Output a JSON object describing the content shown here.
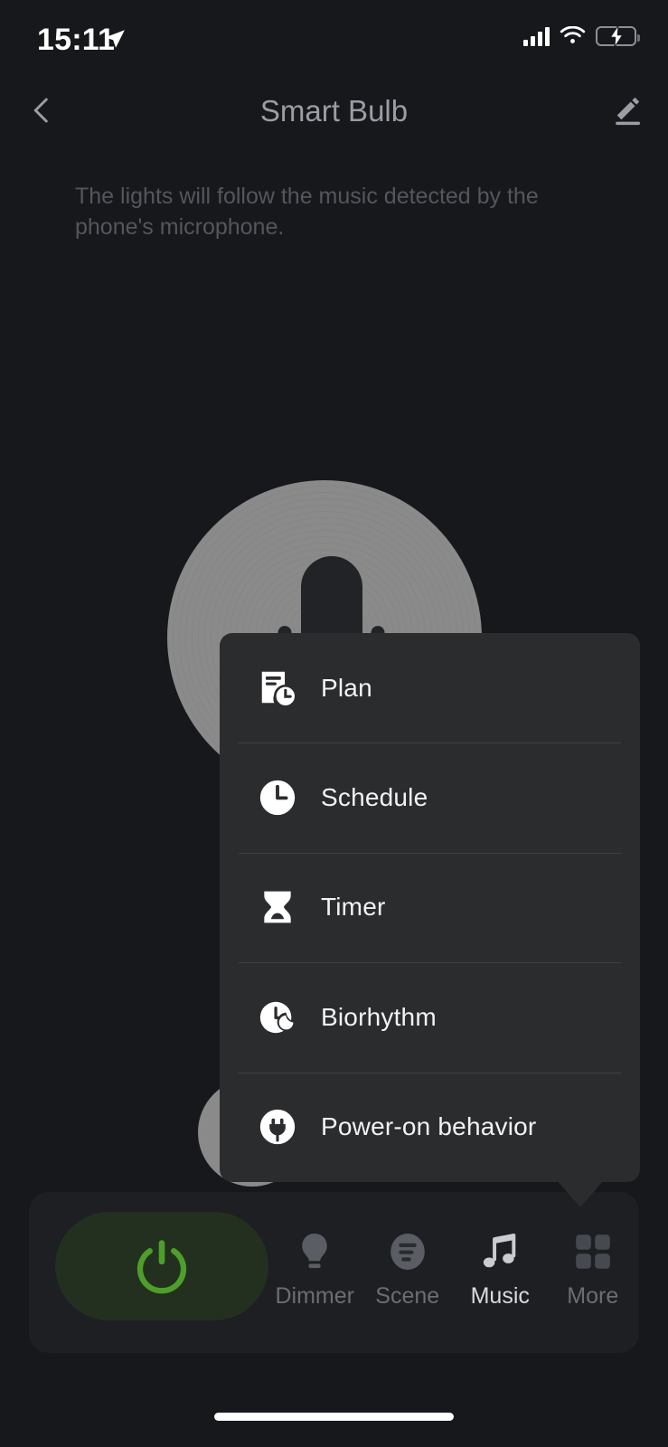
{
  "status_bar": {
    "time": "15:11",
    "location_icon": "location-arrow-icon",
    "signal_icon": "cellular-signal-icon",
    "wifi_icon": "wifi-icon",
    "battery_icon": "battery-charging-icon",
    "battery_color": "#3ddc64"
  },
  "header": {
    "back_icon": "chevron-left-icon",
    "title": "Smart Bulb",
    "edit_icon": "edit-pencil-icon"
  },
  "main": {
    "description": "The lights will follow the music detected by the phone's microphone.",
    "graphic": "microphone-graphic"
  },
  "menu": {
    "items": [
      {
        "label": "Plan",
        "icon": "plan-document-clock-icon"
      },
      {
        "label": "Schedule",
        "icon": "clock-icon"
      },
      {
        "label": "Timer",
        "icon": "hourglass-icon"
      },
      {
        "label": "Biorhythm",
        "icon": "sun-moon-icon"
      },
      {
        "label": "Power-on behavior",
        "icon": "power-plug-icon"
      }
    ]
  },
  "tabbar": {
    "power": {
      "icon": "power-icon",
      "color": "#4e9e2b"
    },
    "tabs": [
      {
        "label": "Dimmer",
        "icon": "bulb-icon",
        "active": false
      },
      {
        "label": "Scene",
        "icon": "scene-icon",
        "active": false
      },
      {
        "label": "Music",
        "icon": "music-note-icon",
        "active": true
      },
      {
        "label": "More",
        "icon": "grid-icon",
        "active": false
      }
    ]
  },
  "system": {
    "home_indicator": "home-indicator"
  }
}
